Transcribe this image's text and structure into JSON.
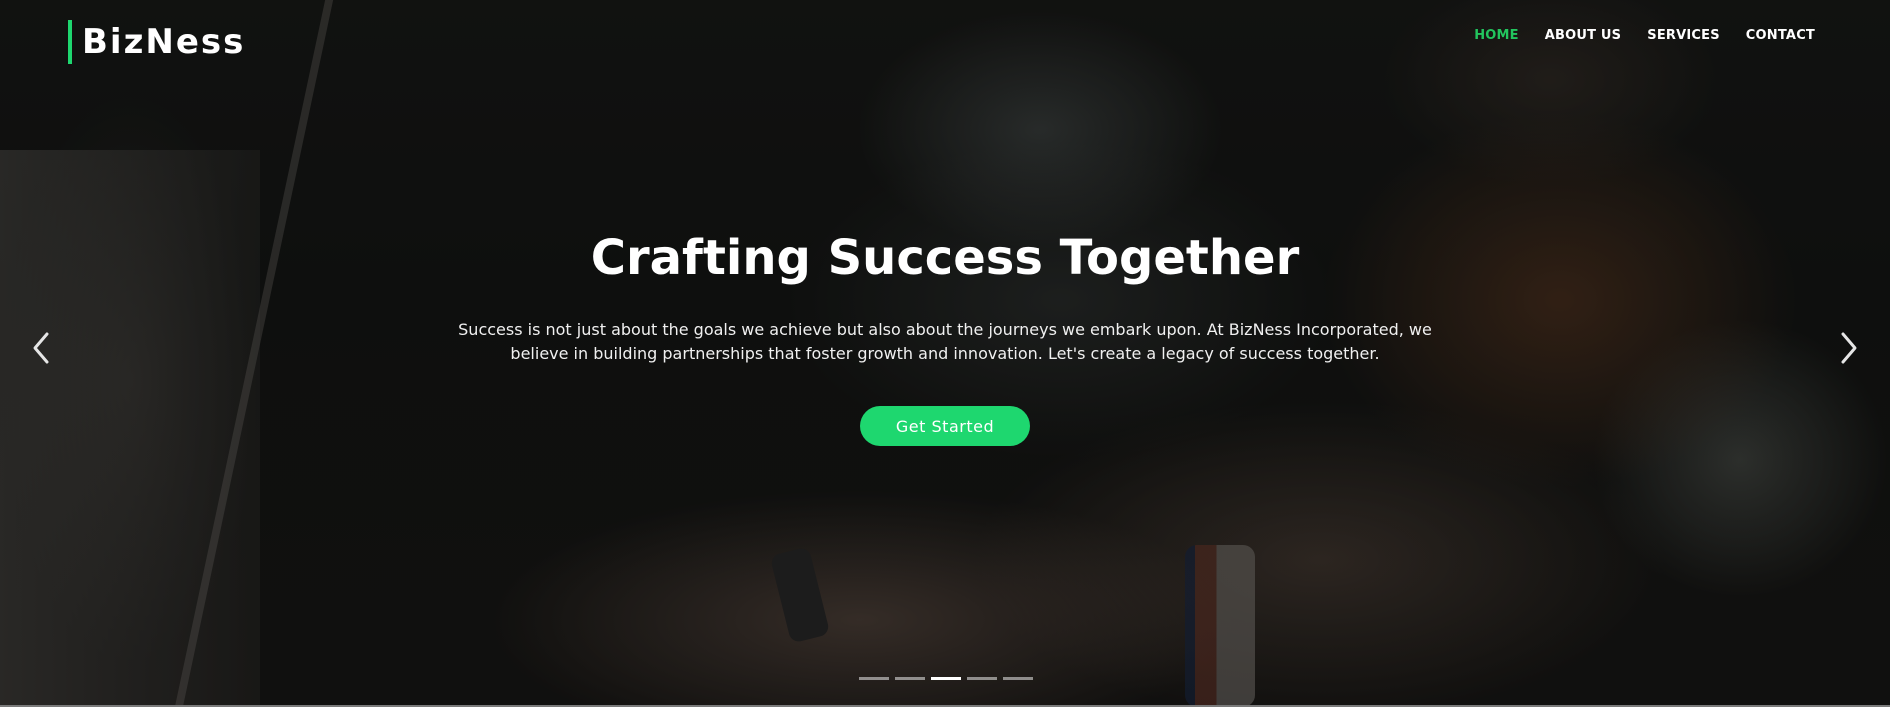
{
  "brand": {
    "name": "BizNess",
    "accent_color": "#1ed76f"
  },
  "nav": {
    "items": [
      {
        "label": "HOME",
        "active": true
      },
      {
        "label": "ABOUT US",
        "active": false
      },
      {
        "label": "SERVICES",
        "active": false
      },
      {
        "label": "CONTACT",
        "active": false
      }
    ],
    "active_color": "#22c55e"
  },
  "hero": {
    "title": "Crafting Success Together",
    "description": "Success is not just about the goals we achieve but also about the journeys we embark upon. At BizNess Incorporated, we believe in building partnerships that foster growth and innovation. Let's create a legacy of success together.",
    "cta_label": "Get Started",
    "background_image": "blurred photo of hands typing on a laptop"
  },
  "carousel": {
    "prev_icon": "chevron-left-icon",
    "next_icon": "chevron-right-icon",
    "slide_count": 5,
    "active_index": 2
  }
}
